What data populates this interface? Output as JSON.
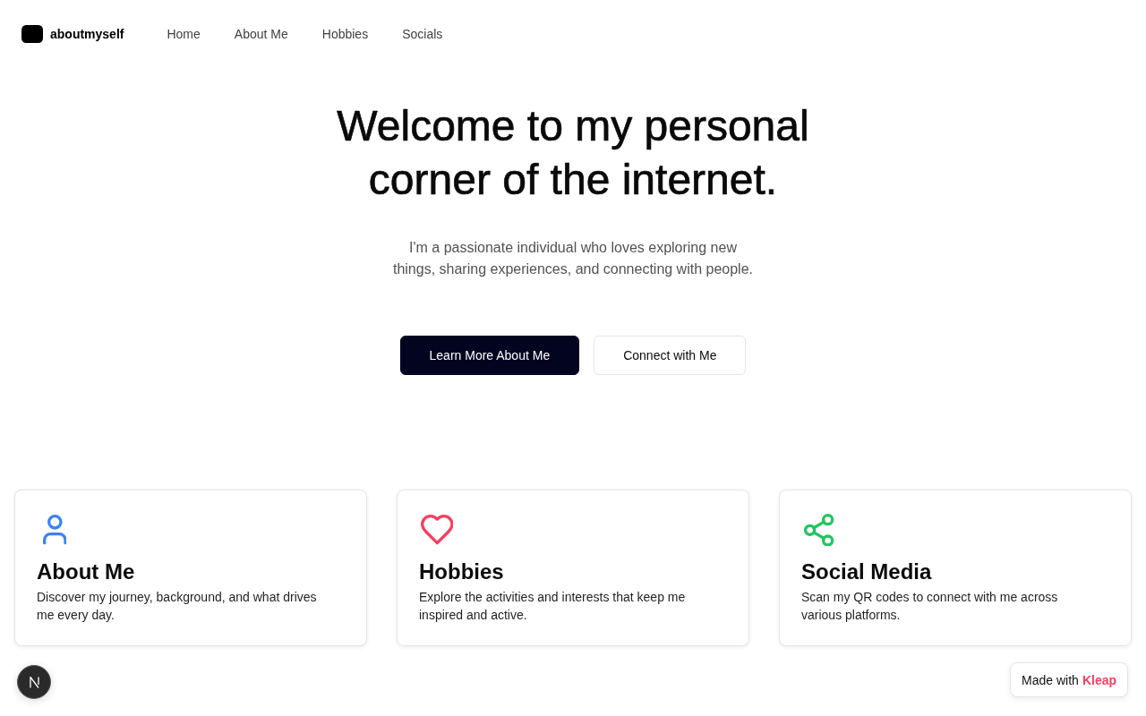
{
  "header": {
    "brand": "aboutmyself",
    "nav": [
      "Home",
      "About Me",
      "Hobbies",
      "Socials"
    ]
  },
  "hero": {
    "title": "Welcome to my personal corner of the internet.",
    "subtitle": "I'm a passionate individual who loves exploring new things, sharing experiences, and connecting with people.",
    "buttons": [
      {
        "label": "Learn More About Me",
        "kind": "primary"
      },
      {
        "label": "Connect with Me",
        "kind": "secondary"
      }
    ]
  },
  "cards": [
    {
      "kind": "person",
      "color": "#3b82f6",
      "title": "About Me",
      "description": "Discover my journey, background, and what drives me every day."
    },
    {
      "kind": "heart",
      "color": "#f43f5e",
      "title": "Hobbies",
      "description": "Explore the activities and interests that keep me inspired and active."
    },
    {
      "kind": "share",
      "color": "#22c55e",
      "title": "Social Media",
      "description": "Scan my QR codes to connect with me across various platforms."
    }
  ],
  "badge": {
    "prefix": "Made with",
    "brand": "Kleap"
  }
}
